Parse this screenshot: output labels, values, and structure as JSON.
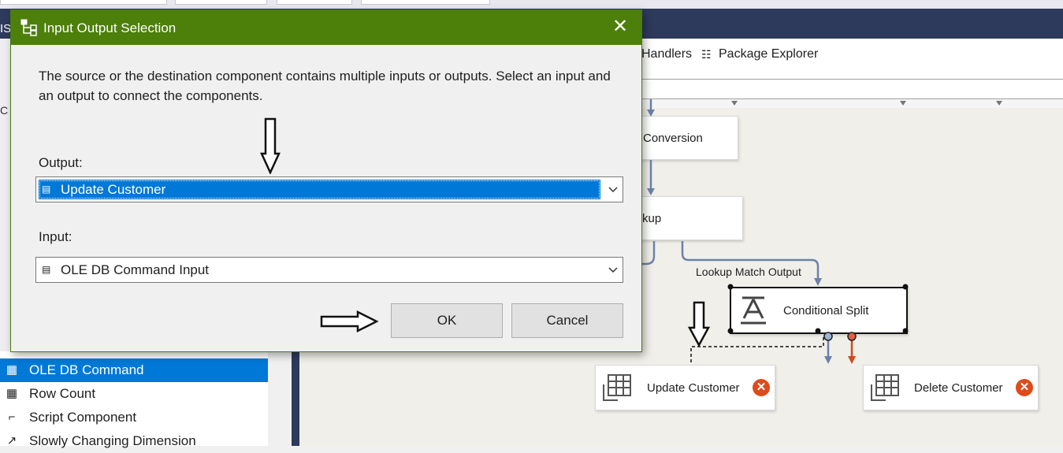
{
  "dialog": {
    "title": "Input Output Selection",
    "close_glyph": "✕",
    "message": "The source or the destination component contains multiple inputs or outputs. Select an input and an output to connect the components.",
    "output_label": "Output:",
    "output_value": "Update Customer",
    "input_label": "Input:",
    "input_value": "OLE DB Command Input",
    "ok_label": "OK",
    "cancel_label": "Cancel"
  },
  "background": {
    "app_badge": "IS",
    "designer_tabs": [
      "Handlers",
      "Package Explorer"
    ],
    "sidebar_items": [
      {
        "label": "OLE DB Command",
        "icon": "ole-db-command-icon",
        "selected": true
      },
      {
        "label": "Row Count",
        "icon": "row-count-icon",
        "selected": false
      },
      {
        "label": "Script Component",
        "icon": "script-component-icon",
        "selected": false
      },
      {
        "label": "Slowly Changing Dimension",
        "icon": "scd-icon",
        "selected": false
      }
    ],
    "left_strip_letters": [
      "C"
    ],
    "canvas": {
      "nodes": {
        "conversion": "Conversion",
        "lookup": "kup",
        "conditional_split": "Conditional Split",
        "update_customer": "Update Customer",
        "delete_customer": "Delete Customer"
      },
      "path_label": "Lookup Match Output",
      "error_glyph": "✕"
    }
  },
  "colors": {
    "dialog_title_bar": "#4d7f0b",
    "selection": "#0078d7",
    "ide_dark": "#2d3a5c",
    "error_badge": "#e04a1a",
    "path_arrow": "#6b82a8",
    "error_path": "#d04a1a"
  }
}
